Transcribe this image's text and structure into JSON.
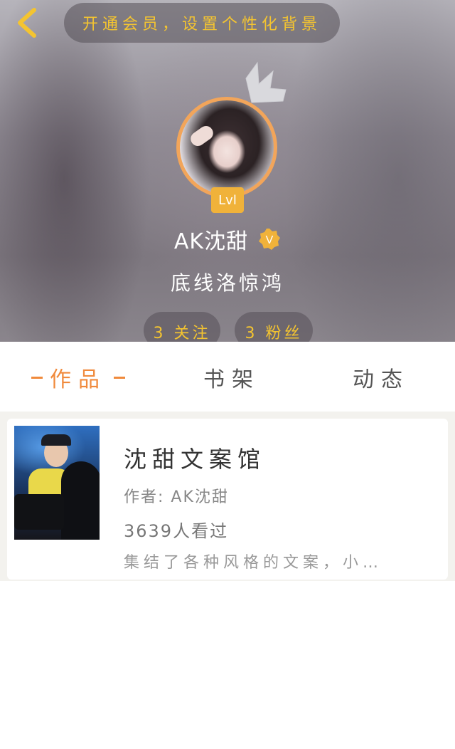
{
  "header": {
    "vip_banner": "开通会员，设置个性化背景",
    "level": "Lvl",
    "username": "AK沈甜",
    "verified_mark": "V",
    "bio": "底线洛惊鸿",
    "following": "3 关注",
    "fans": "3 粉丝"
  },
  "tabs": {
    "works": "作品",
    "bookshelf": "书架",
    "feed": "动态"
  },
  "works": [
    {
      "title": "沈甜文案馆",
      "author": "作者: AK沈甜",
      "views": "3639人看过",
      "description": "集结了各种风格的文案，小…"
    }
  ],
  "icons": {
    "back": "chevron-left-icon",
    "crown": "crown-icon",
    "verified": "verified-v-icon"
  },
  "colors": {
    "accent_orange": "#f08a3c",
    "banner_gold": "#f4c430",
    "badge_gold": "#f0b23a"
  }
}
